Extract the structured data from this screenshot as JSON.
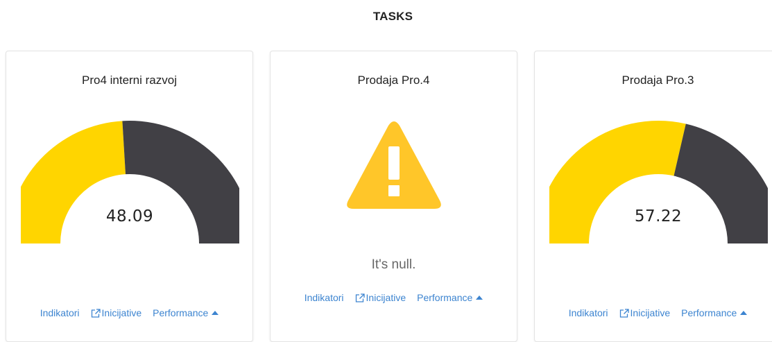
{
  "page_title": "TASKS",
  "colors": {
    "gauge_fill": "#ffd500",
    "gauge_rest": "#414045",
    "warning": "#ffc629",
    "link": "#3c84d0"
  },
  "links": {
    "indicators": "Indikatori",
    "initiatives": "Inicijative",
    "performance": "Performance"
  },
  "cards": [
    {
      "title": "Pro4 interni razvoj",
      "gauge_value": "48.09",
      "gauge_fraction": 0.4809
    },
    {
      "title": "Prodaja Pro.4",
      "status": "It's null.",
      "icon": "warning-icon"
    },
    {
      "title": "Prodaja Pro.3",
      "gauge_value": "57.22",
      "gauge_fraction": 0.5722
    }
  ]
}
